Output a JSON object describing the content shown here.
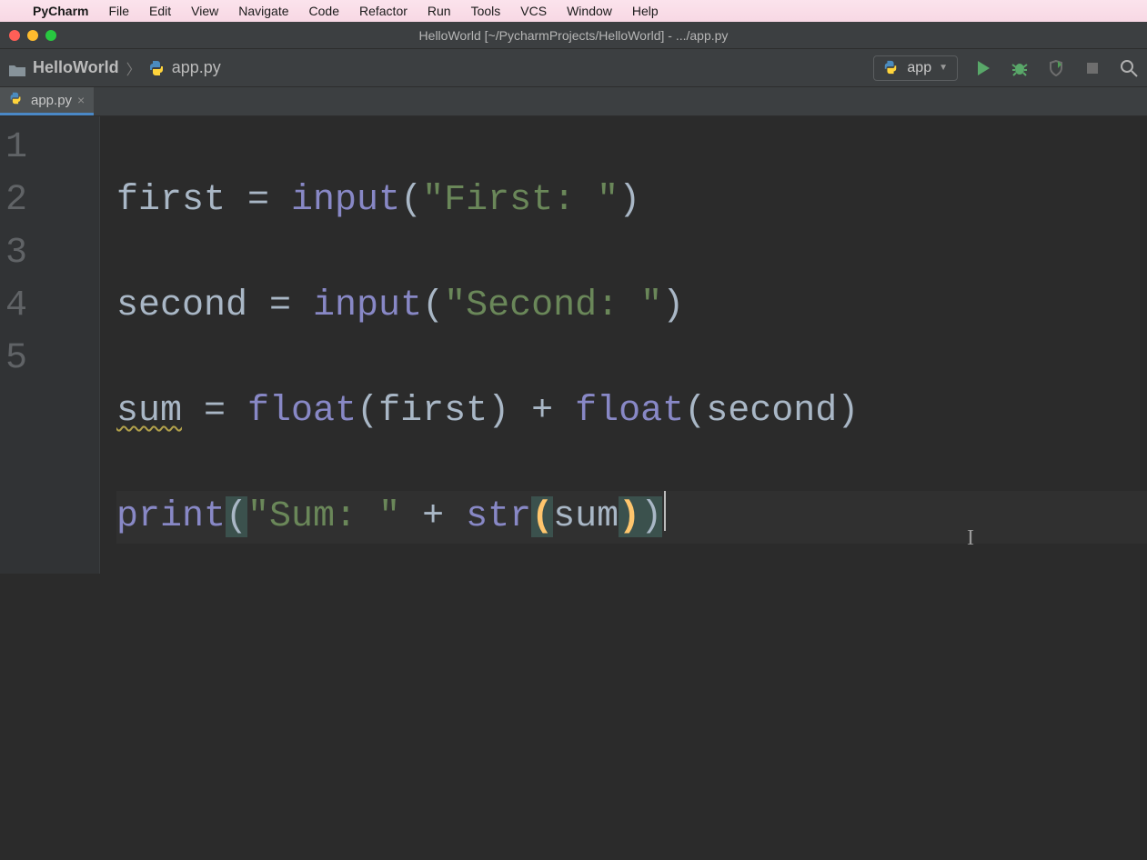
{
  "mac_menu": {
    "app_name": "PyCharm",
    "items": [
      "File",
      "Edit",
      "View",
      "Navigate",
      "Code",
      "Refactor",
      "Run",
      "Tools",
      "VCS",
      "Window",
      "Help"
    ]
  },
  "window": {
    "title": "HelloWorld [~/PycharmProjects/HelloWorld] - .../app.py"
  },
  "breadcrumb": {
    "project": "HelloWorld",
    "file": "app.py"
  },
  "run_config": {
    "label": "app"
  },
  "tabs": [
    {
      "label": "app.py"
    }
  ],
  "editor": {
    "line_numbers": [
      "1",
      "2",
      "3",
      "4",
      "5"
    ],
    "code": {
      "l1": {
        "v1": "first ",
        "eq": "= ",
        "fn": "input",
        "p1": "(",
        "s": "\"First: \"",
        "p2": ")"
      },
      "l2": {
        "v1": "second ",
        "eq": "= ",
        "fn": "input",
        "p1": "(",
        "s": "\"Second: \"",
        "p2": ")"
      },
      "l3": {
        "v1": "sum",
        "sp": " ",
        "eq": "= ",
        "fn1": "float",
        "p1": "(",
        "a1": "first",
        "p2": ")",
        "plus": " + ",
        "fn2": "float",
        "p3": "(",
        "a2": "second",
        "p4": ")"
      },
      "l4": {
        "fn1": "print",
        "p1": "(",
        "s": "\"Sum: \"",
        "plus": " + ",
        "fn2": "str",
        "p2": "(",
        "a": "sum",
        "p3": ")",
        "p4": ")"
      }
    }
  }
}
